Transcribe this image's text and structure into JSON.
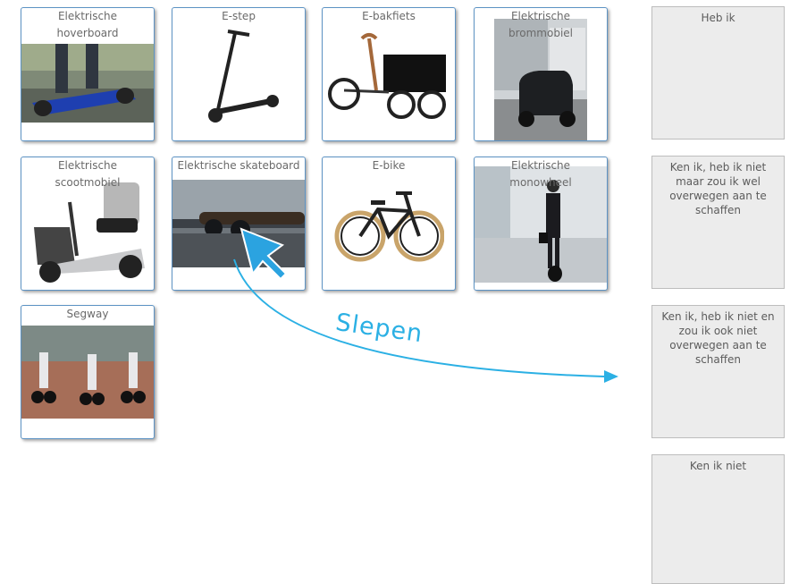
{
  "cards": [
    {
      "title_line1": "Elektrische",
      "title_line2": "hoverboard"
    },
    {
      "title_line1": "E-step",
      "title_line2": ""
    },
    {
      "title_line1": "E-bakfiets",
      "title_line2": ""
    },
    {
      "title_line1": "Elektrische",
      "title_line2": "brommobiel"
    },
    {
      "title_line1": "Elektrische",
      "title_line2": "scootmobiel"
    },
    {
      "title_line1": "Elektrische skateboard",
      "title_line2": ""
    },
    {
      "title_line1": "E-bike",
      "title_line2": ""
    },
    {
      "title_line1": "Elektrische",
      "title_line2": "monowheel"
    },
    {
      "title_line1": "Segway",
      "title_line2": ""
    }
  ],
  "zones": [
    {
      "label": "Heb ik"
    },
    {
      "label": "Ken ik, heb ik niet maar zou ik wel overwegen aan te schaffen"
    },
    {
      "label": "Ken ik, heb ik niet en zou ik ook niet overwegen aan te schaffen"
    },
    {
      "label": "Ken ik niet"
    }
  ],
  "hint": {
    "text": "Slepen",
    "color": "#2bb0e4"
  }
}
